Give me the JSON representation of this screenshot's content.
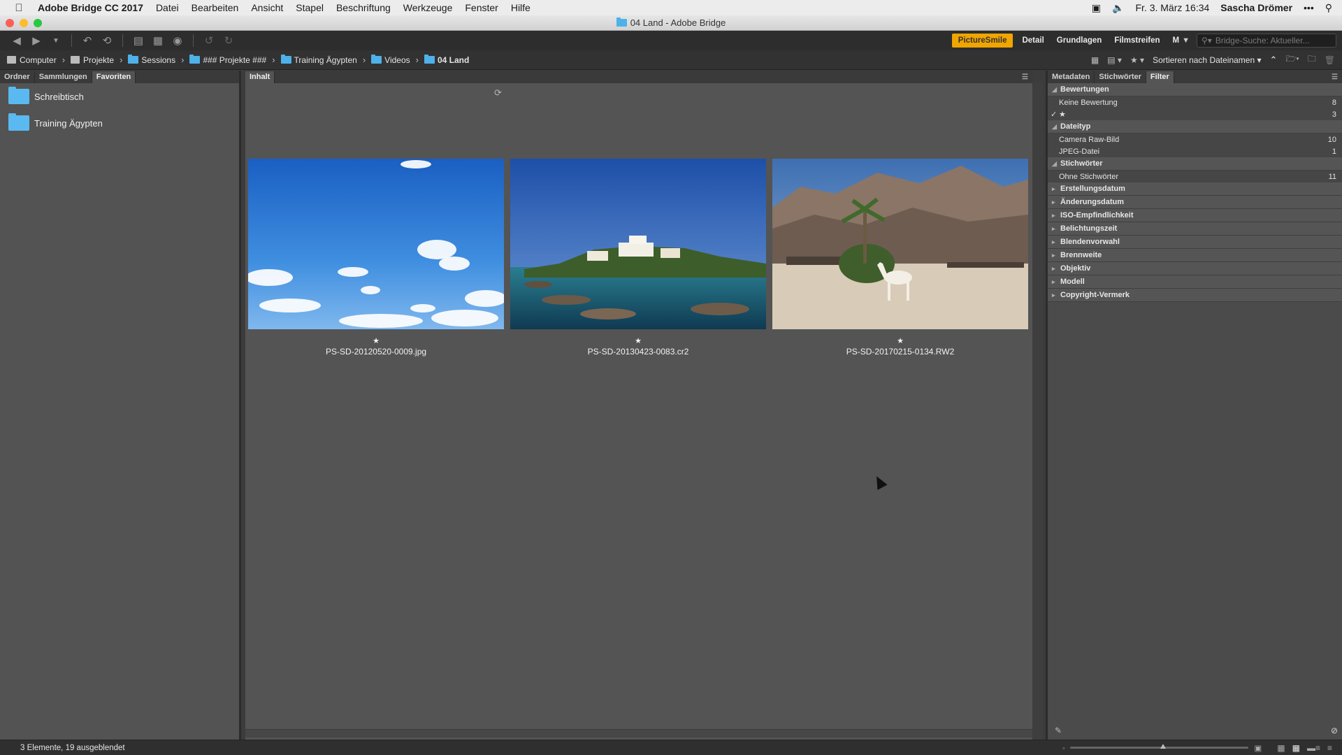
{
  "menubar": {
    "app": "Adobe Bridge CC 2017",
    "items": [
      "Datei",
      "Bearbeiten",
      "Ansicht",
      "Stapel",
      "Beschriftung",
      "Werkzeuge",
      "Fenster",
      "Hilfe"
    ],
    "datetime": "Fr. 3. März  16:34",
    "user": "Sascha Drömer"
  },
  "window": {
    "title": "04 Land - Adobe Bridge"
  },
  "toolbar": {
    "workspaces": [
      "PictureSmile",
      "Detail",
      "Grundlagen",
      "Filmstreifen",
      "M"
    ],
    "active_workspace": "PictureSmile",
    "search_placeholder": "Bridge-Suche: Aktueller..."
  },
  "pathbar": {
    "crumbs": [
      "Computer",
      "Projekte",
      "Sessions",
      "### Projekte ###",
      "Training Ägypten",
      "Videos",
      "04 Land"
    ],
    "sort_label": "Sortieren nach Dateinamen"
  },
  "left_panel": {
    "tabs": [
      "Ordner",
      "Sammlungen",
      "Favoriten"
    ],
    "active_tab": "Favoriten",
    "favorites": [
      "Schreibtisch",
      "Training Ägypten"
    ]
  },
  "content": {
    "tab": "Inhalt",
    "items": [
      {
        "name": "PS-SD-20120520-0009.jpg",
        "rating": "★"
      },
      {
        "name": "PS-SD-20130423-0083.cr2",
        "rating": "★"
      },
      {
        "name": "PS-SD-20170215-0134.RW2",
        "rating": "★"
      }
    ]
  },
  "right_panel": {
    "tabs": [
      "Metadaten",
      "Stichwörter",
      "Filter"
    ],
    "active_tab": "Filter",
    "sections": [
      {
        "title": "Bewertungen",
        "expanded": true,
        "rows": [
          {
            "label": "Keine Bewertung",
            "count": "8",
            "checked": false
          },
          {
            "label": "★",
            "count": "3",
            "checked": true
          }
        ]
      },
      {
        "title": "Dateityp",
        "expanded": true,
        "rows": [
          {
            "label": "Camera Raw-Bild",
            "count": "10",
            "checked": false
          },
          {
            "label": "JPEG-Datei",
            "count": "1",
            "checked": false
          }
        ]
      },
      {
        "title": "Stichwörter",
        "expanded": true,
        "rows": [
          {
            "label": "Ohne Stichwörter",
            "count": "11",
            "checked": false
          }
        ]
      },
      {
        "title": "Erstellungsdatum",
        "expanded": false,
        "rows": []
      },
      {
        "title": "Änderungsdatum",
        "expanded": false,
        "rows": []
      },
      {
        "title": "ISO-Empfindlichkeit",
        "expanded": false,
        "rows": []
      },
      {
        "title": "Belichtungszeit",
        "expanded": false,
        "rows": []
      },
      {
        "title": "Blendenvorwahl",
        "expanded": false,
        "rows": []
      },
      {
        "title": "Brennweite",
        "expanded": false,
        "rows": []
      },
      {
        "title": "Objektiv",
        "expanded": false,
        "rows": []
      },
      {
        "title": "Modell",
        "expanded": false,
        "rows": []
      },
      {
        "title": "Copyright-Vermerk",
        "expanded": false,
        "rows": []
      }
    ]
  },
  "statusbar": {
    "text": "3 Elemente, 19 ausgeblendet",
    "thumbnail_zoom_fraction": 0.52
  },
  "colors": {
    "accent": "#f0a500",
    "folder": "#5ab9f0"
  }
}
